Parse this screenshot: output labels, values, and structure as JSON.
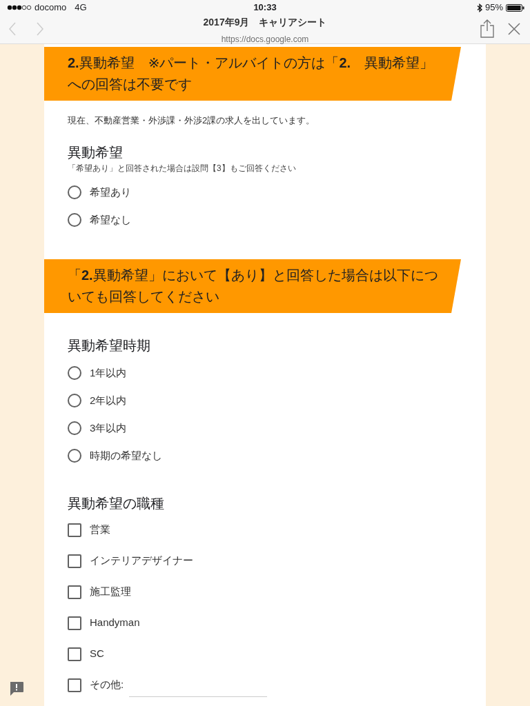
{
  "status_bar": {
    "carrier": "docomo",
    "network": "4G",
    "time": "10:33",
    "battery": "95%"
  },
  "browser": {
    "title": "2017年9月　キャリアシート",
    "url": "https://docs.google.com"
  },
  "sections": [
    {
      "header": "**2.**異動希望　※パート・アルバイトの方は「**2.**　異動希望」への回答は不要です",
      "description": "現在、不動産営業・外渉課・外渉2課の求人を出しています。",
      "questions": [
        {
          "kind": "radio",
          "title": "異動希望",
          "help": "「希望あり」と回答された場合は設問【3】もご回答ください",
          "options": [
            {
              "kind": "choice",
              "label": "希望あり",
              "selected": false
            },
            {
              "kind": "choice",
              "label": "希望なし",
              "selected": false
            }
          ]
        }
      ]
    },
    {
      "header": "「**2.**異動希望」において【あり】と回答した場合は以下についても回答してください",
      "questions": [
        {
          "kind": "radio",
          "title": "異動希望時期",
          "options": [
            {
              "kind": "choice",
              "label": "1年以内",
              "selected": false
            },
            {
              "kind": "choice",
              "label": "2年以内",
              "selected": false
            },
            {
              "kind": "choice",
              "label": "3年以内",
              "selected": false
            },
            {
              "kind": "choice",
              "label": "時期の希望なし",
              "selected": false
            }
          ]
        },
        {
          "kind": "checkbox",
          "title": "異動希望の職種",
          "options": [
            {
              "kind": "choice",
              "label": "営業",
              "checked": false
            },
            {
              "kind": "choice",
              "label": "インテリアデザイナー",
              "checked": false
            },
            {
              "kind": "choice",
              "label": "施工監理",
              "checked": false
            },
            {
              "kind": "choice",
              "label": "Handyman",
              "checked": false
            },
            {
              "kind": "choice",
              "label": "SC",
              "checked": false
            },
            {
              "kind": "other",
              "label": "その他:",
              "checked": false
            }
          ]
        }
      ]
    }
  ]
}
